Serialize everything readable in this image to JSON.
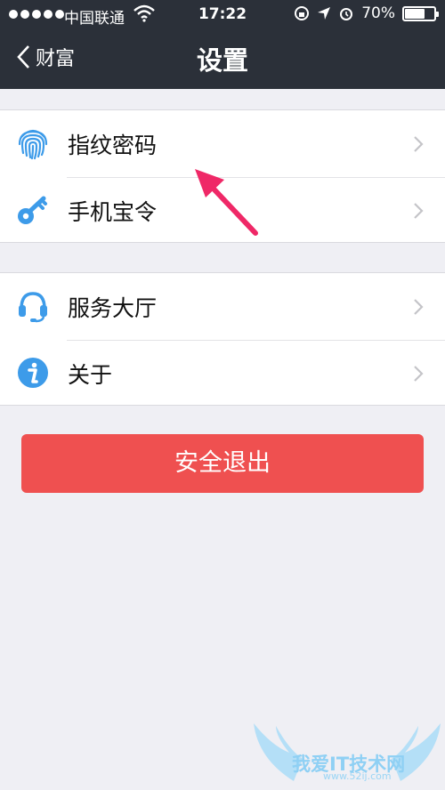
{
  "status_bar": {
    "carrier": "中国联通",
    "time": "17:22",
    "battery": "70%",
    "battery_level": 0.7
  },
  "nav": {
    "back_label": "财富",
    "title": "设置"
  },
  "settings": {
    "items": [
      {
        "label": "指纹密码",
        "icon": "fingerprint-icon"
      },
      {
        "label": "手机宝令",
        "icon": "key-icon"
      },
      {
        "label": "服务大厅",
        "icon": "headset-icon"
      },
      {
        "label": "关于",
        "icon": "info-icon"
      }
    ]
  },
  "logout_label": "安全退出",
  "watermark": {
    "text": "我爱IT技术网",
    "url": "www.52ij.com"
  },
  "colors": {
    "navbar": "#2b3039",
    "icon_blue": "#3d9be9",
    "logout_red": "#ef5050",
    "annotation_pink": "#ef2867"
  }
}
